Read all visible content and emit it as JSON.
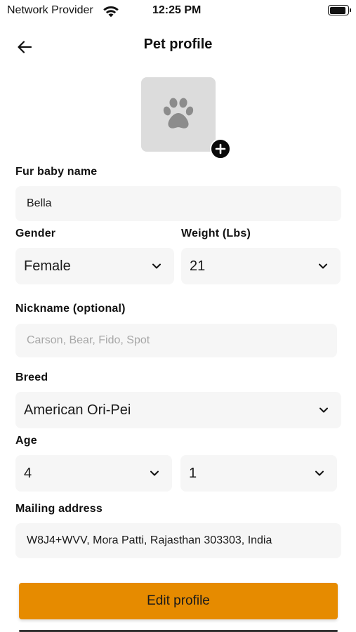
{
  "status_bar": {
    "carrier": "Network Provider",
    "time": "12:25 PM",
    "battery_level": 0.9,
    "icons": [
      "wifi-icon",
      "battery-icon"
    ]
  },
  "header": {
    "title": "Pet profile",
    "back_icon": "arrow-left-icon"
  },
  "avatar": {
    "icon": "paw-icon",
    "add_icon": "plus-circle-icon"
  },
  "form": {
    "name": {
      "label": "Fur baby name",
      "value": "Bella"
    },
    "gender": {
      "label": "Gender",
      "value": "Female"
    },
    "weight": {
      "label": "Weight (Lbs)",
      "value": "21"
    },
    "nickname": {
      "label": "Nickname (optional)",
      "placeholder": "Carson, Bear, Fido, Spot"
    },
    "breed": {
      "label": "Breed",
      "value": "American Ori-Pei"
    },
    "age": {
      "label": "Age",
      "years": "4",
      "months": "1"
    },
    "address": {
      "label": "Mailing address",
      "value": "W8J4+WVV, Mora Patti, Rajasthan 303303, India"
    }
  },
  "actions": {
    "edit_label": "Edit profile"
  },
  "colors": {
    "accent": "#e68b00",
    "field_bg": "#f6f6f6",
    "avatar_bg": "#dcdcdc",
    "placeholder": "#a7a7a7"
  }
}
